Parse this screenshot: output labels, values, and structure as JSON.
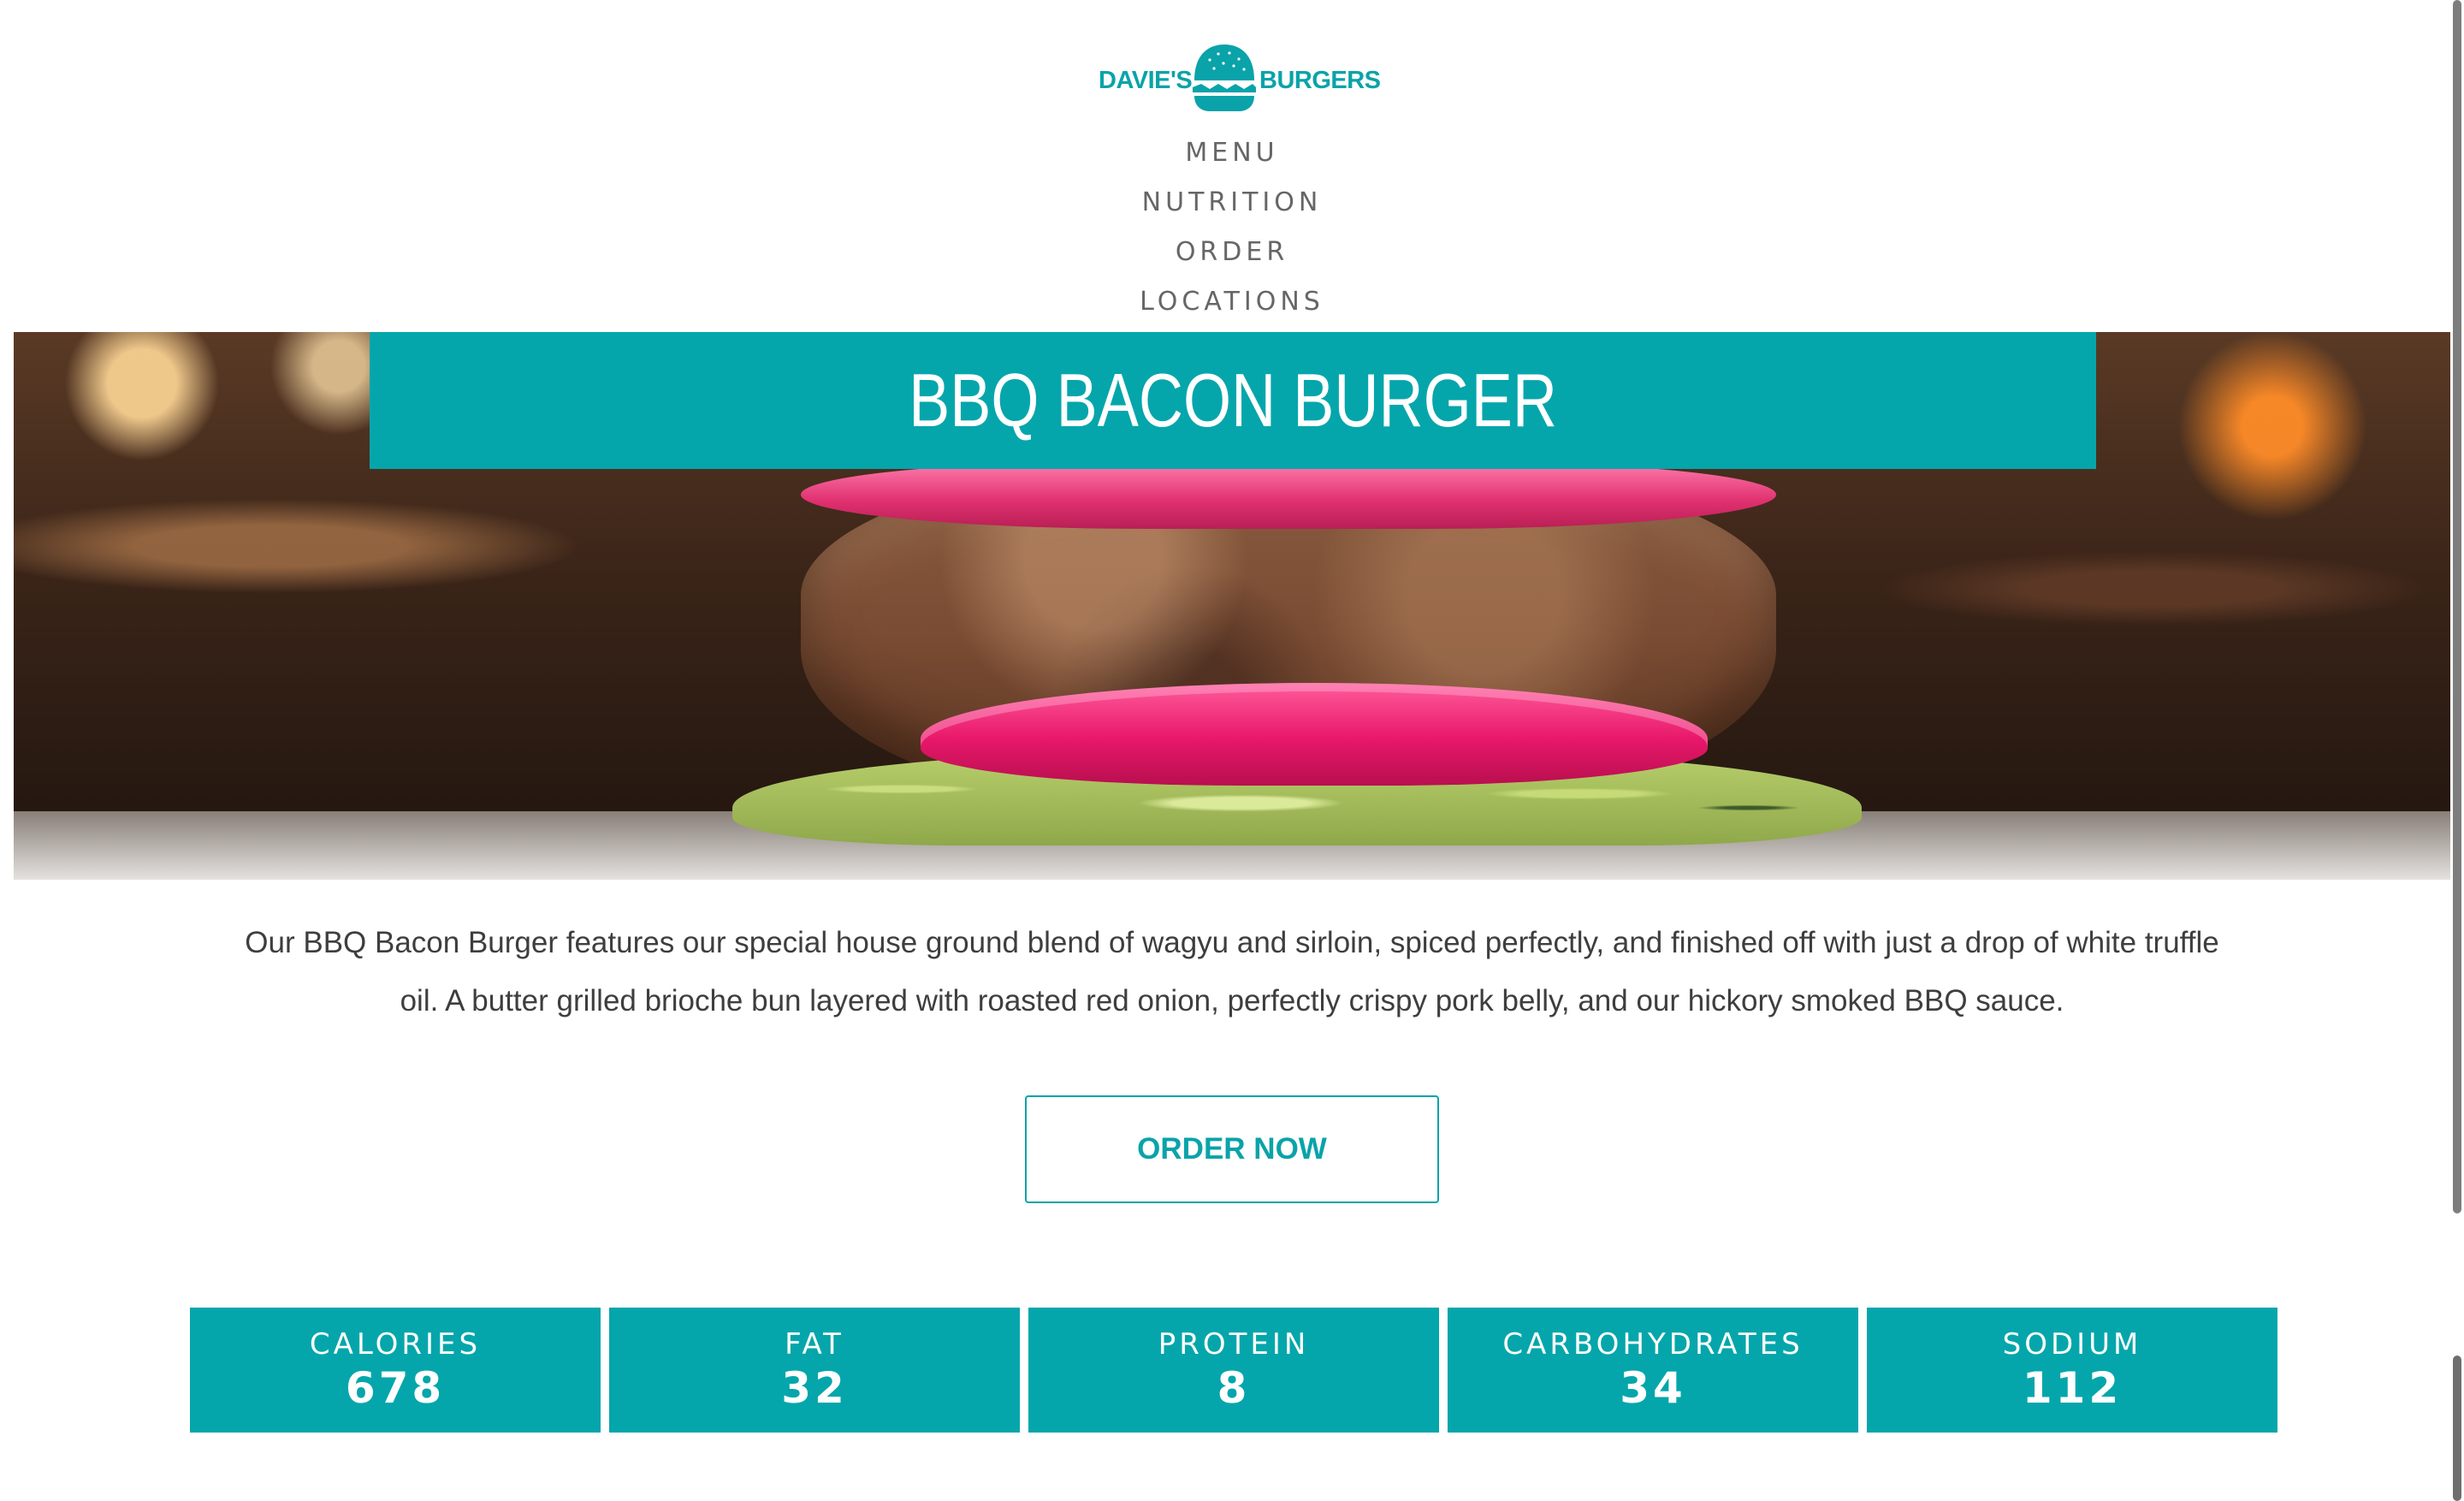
{
  "brand": {
    "left_word": "DAVIE'S",
    "right_word": "BURGERS",
    "color": "#0aa3a9"
  },
  "nav": {
    "items": [
      {
        "label": "MENU"
      },
      {
        "label": "NUTRITION"
      },
      {
        "label": "ORDER"
      },
      {
        "label": "LOCATIONS"
      }
    ]
  },
  "hero": {
    "image": "burger-photo",
    "title": "BBQ BACON BURGER",
    "banner_color": "#04a6ab"
  },
  "description": {
    "line1": "Our BBQ Bacon Burger features our special house ground blend of wagyu and sirloin, spiced perfectly, and finished off with just a drop of white truffle",
    "line2": "oil. A butter grilled brioche bun layered with roasted red onion, perfectly crispy pork belly, and our hickory smoked BBQ sauce."
  },
  "order_button": {
    "label": "ORDER NOW"
  },
  "nutrition": [
    {
      "label": "CALORIES",
      "value": "678"
    },
    {
      "label": "FAT",
      "value": "32"
    },
    {
      "label": "PROTEIN",
      "value": "8"
    },
    {
      "label": "CARBOHYDRATES",
      "value": "34"
    },
    {
      "label": "SODIUM",
      "value": "112"
    }
  ]
}
